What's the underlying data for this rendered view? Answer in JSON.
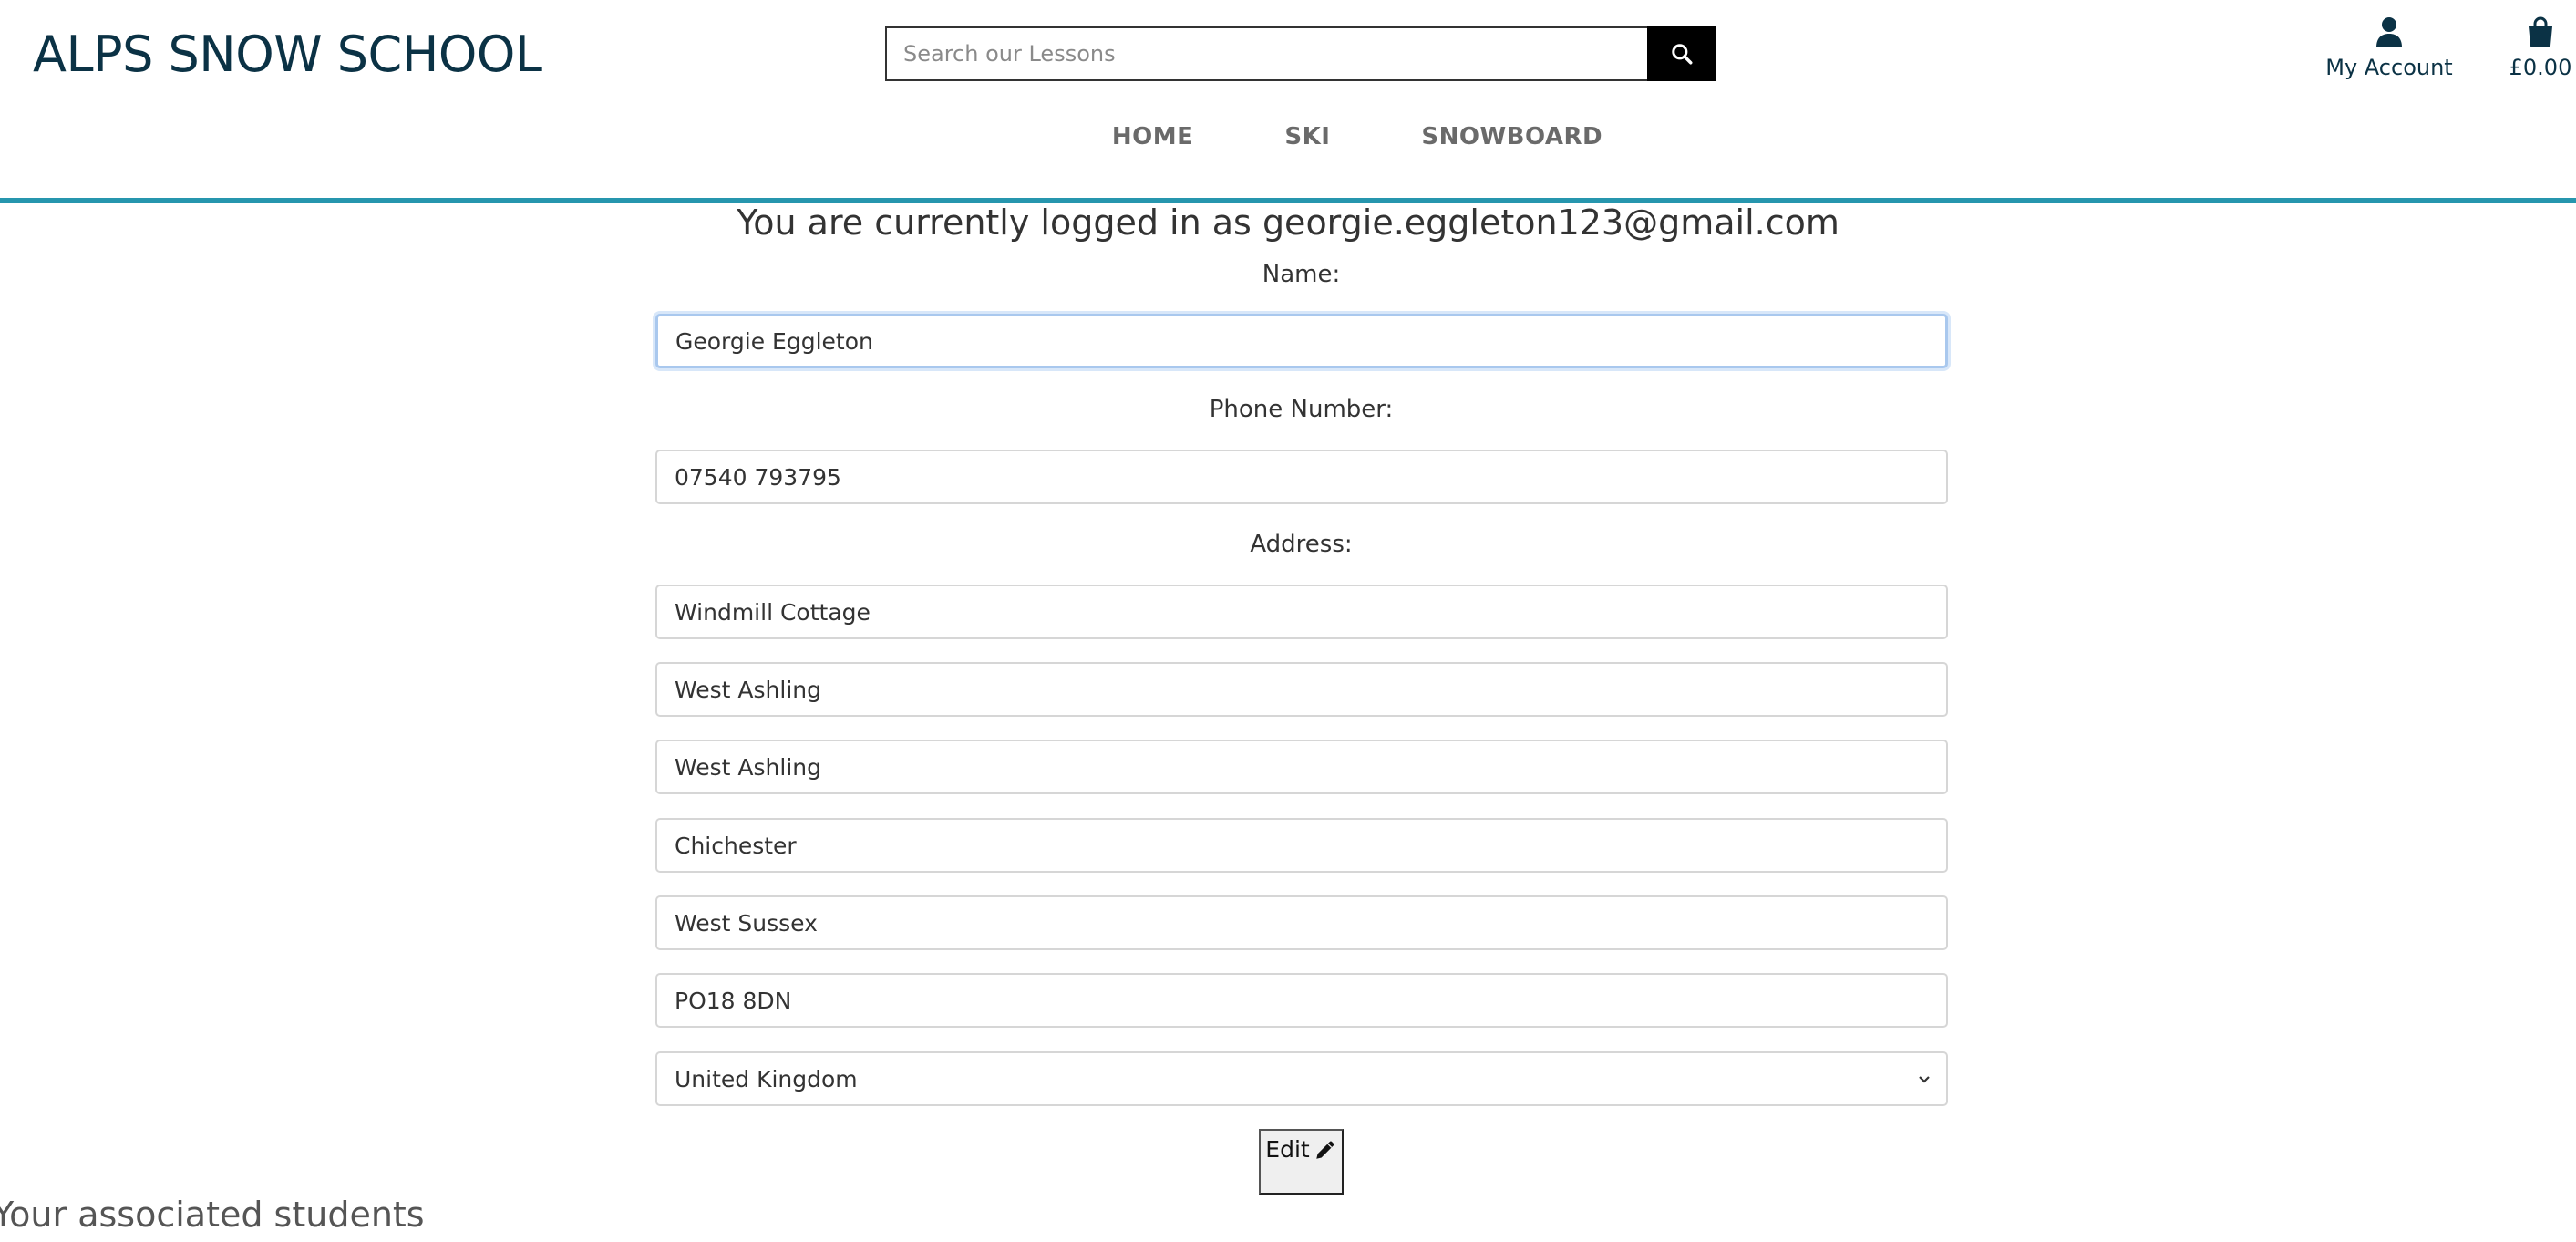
{
  "header": {
    "brand": "ALPS SNOW SCHOOL",
    "search": {
      "placeholder": "Search our Lessons",
      "icon": "search-icon"
    },
    "account_label": "My Account",
    "bag_total": "£0.00",
    "colors": {
      "brand": "#0b3245",
      "accent_rule": "#2696ae"
    }
  },
  "nav": {
    "items": [
      "HOME",
      "SKI",
      "SNOWBOARD"
    ]
  },
  "profile": {
    "status": "You are currently logged in as georgie.eggleton123@gmail.com",
    "name_label": "Name:",
    "name_value": "Georgie Eggleton",
    "phone_label": "Phone Number:",
    "phone_value": "07540 793795",
    "address_label": "Address:",
    "address_lines": [
      "Windmill Cottage",
      "West Ashling",
      "West Ashling",
      "Chichester",
      "West Sussex",
      "PO18 8DN"
    ],
    "country": "United Kingdom",
    "edit_label": "Edit"
  },
  "students": {
    "heading": "Your associated students"
  }
}
